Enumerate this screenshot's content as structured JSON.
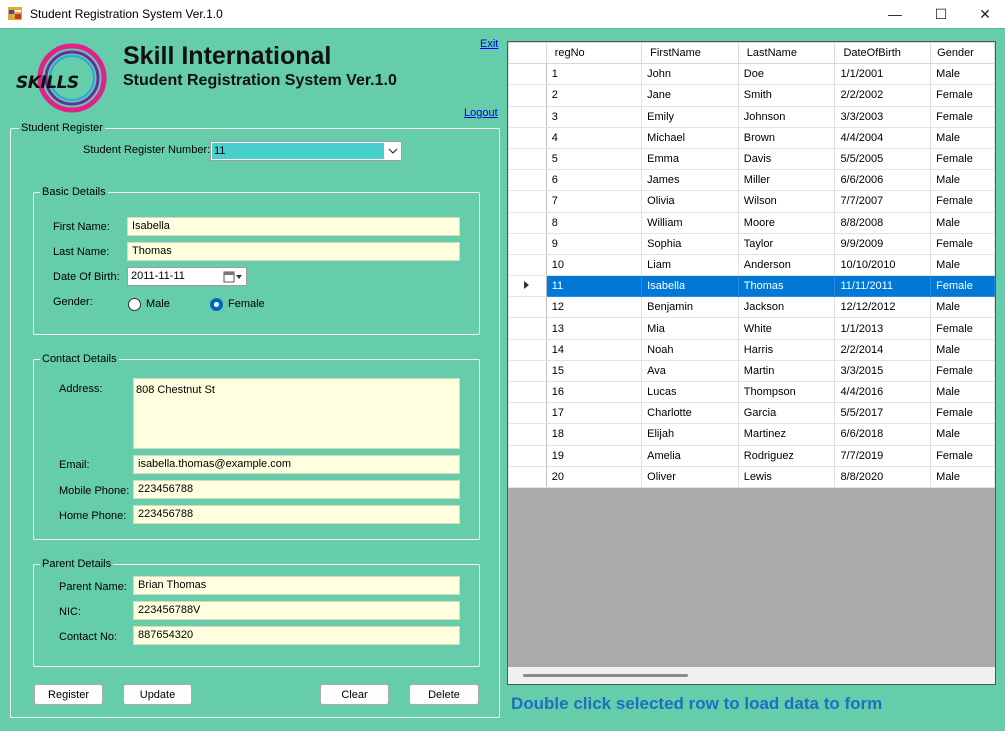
{
  "window": {
    "title": "Student Registration System Ver.1.0",
    "controls": {
      "minimize": "—",
      "maximize": "☐",
      "close": "✕"
    }
  },
  "brand": {
    "logo_text": "SKILLS",
    "title": "Skill International",
    "subtitle": "Student Registration System Ver.1.0"
  },
  "links": {
    "exit": "Exit",
    "logout": "Logout"
  },
  "student_register": {
    "group_title": "Student Register",
    "reg_no_label": "Student Register Number:",
    "reg_no_value": "11"
  },
  "basic": {
    "group_title": "Basic Details",
    "first_name_label": "First Name:",
    "first_name": "Isabella",
    "last_name_label": "Last Name:",
    "last_name": "Thomas",
    "dob_label": "Date Of Birth:",
    "dob": "2011-11-11",
    "gender_label": "Gender:",
    "male_label": "Male",
    "female_label": "Female",
    "gender_selected": "Female"
  },
  "contact": {
    "group_title": "Contact Details",
    "address_label": "Address:",
    "address": "808 Chestnut St",
    "email_label": "Email:",
    "email": "isabella.thomas@example.com",
    "mobile_label": "Mobile Phone:",
    "mobile": "223456788",
    "home_label": "Home Phone:",
    "home": "223456788"
  },
  "parent": {
    "group_title": "Parent Details",
    "name_label": "Parent Name:",
    "name": "Brian Thomas",
    "nic_label": "NIC:",
    "nic": "223456788V",
    "contact_label": "Contact No:",
    "contact": "887654320"
  },
  "buttons": {
    "register": "Register",
    "update": "Update",
    "clear": "Clear",
    "delete": "Delete"
  },
  "hint": "Double click selected row to load data to form",
  "grid": {
    "columns": [
      "regNo",
      "FirstName",
      "LastName",
      "DateOfBirth",
      "Gender"
    ],
    "selected_row": 10,
    "rows": [
      [
        "1",
        "John",
        "Doe",
        "1/1/2001",
        "Male"
      ],
      [
        "2",
        "Jane",
        "Smith",
        "2/2/2002",
        "Female"
      ],
      [
        "3",
        "Emily",
        "Johnson",
        "3/3/2003",
        "Female"
      ],
      [
        "4",
        "Michael",
        "Brown",
        "4/4/2004",
        "Male"
      ],
      [
        "5",
        "Emma",
        "Davis",
        "5/5/2005",
        "Female"
      ],
      [
        "6",
        "James",
        "Miller",
        "6/6/2006",
        "Male"
      ],
      [
        "7",
        "Olivia",
        "Wilson",
        "7/7/2007",
        "Female"
      ],
      [
        "8",
        "William",
        "Moore",
        "8/8/2008",
        "Male"
      ],
      [
        "9",
        "Sophia",
        "Taylor",
        "9/9/2009",
        "Female"
      ],
      [
        "10",
        "Liam",
        "Anderson",
        "10/10/2010",
        "Male"
      ],
      [
        "11",
        "Isabella",
        "Thomas",
        "11/11/2011",
        "Female"
      ],
      [
        "12",
        "Benjamin",
        "Jackson",
        "12/12/2012",
        "Male"
      ],
      [
        "13",
        "Mia",
        "White",
        "1/1/2013",
        "Female"
      ],
      [
        "14",
        "Noah",
        "Harris",
        "2/2/2014",
        "Male"
      ],
      [
        "15",
        "Ava",
        "Martin",
        "3/3/2015",
        "Female"
      ],
      [
        "16",
        "Lucas",
        "Thompson",
        "4/4/2016",
        "Male"
      ],
      [
        "17",
        "Charlotte",
        "Garcia",
        "5/5/2017",
        "Female"
      ],
      [
        "18",
        "Elijah",
        "Martinez",
        "6/6/2018",
        "Male"
      ],
      [
        "19",
        "Amelia",
        "Rodriguez",
        "7/7/2019",
        "Female"
      ],
      [
        "20",
        "Oliver",
        "Lewis",
        "8/8/2020",
        "Male"
      ]
    ]
  },
  "colors": {
    "background": "#66cdaa",
    "field": "#ffffe0",
    "combo_highlight": "#48d1cc",
    "selection": "#0078d7",
    "hint": "#1e6fc1"
  }
}
